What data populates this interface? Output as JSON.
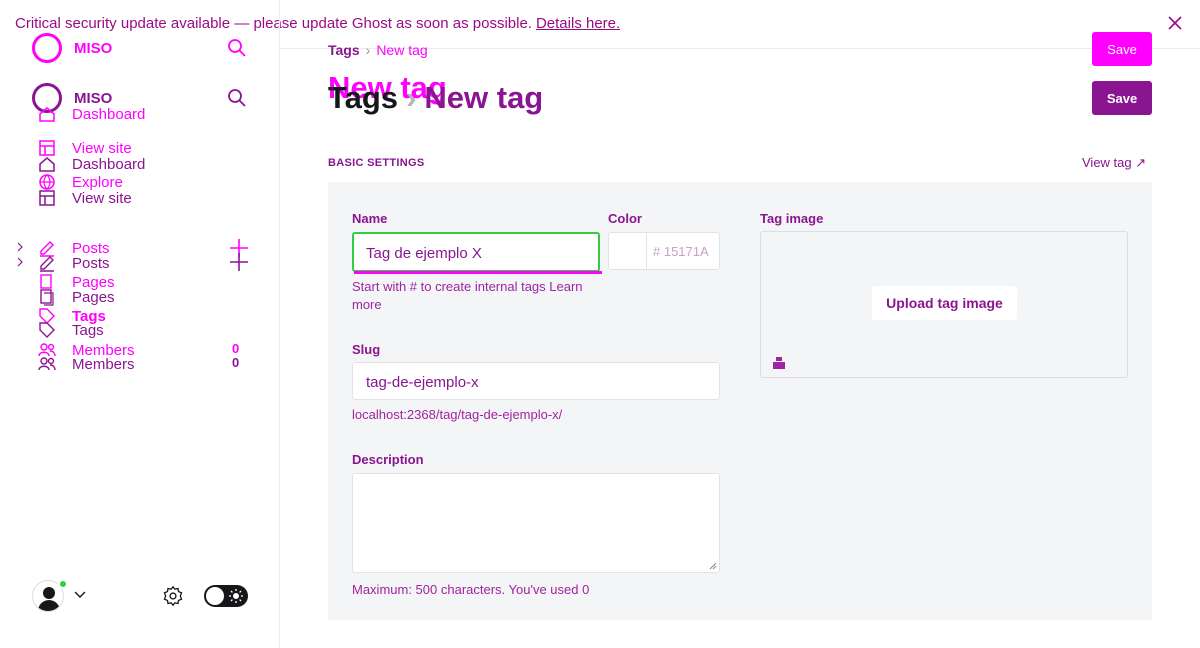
{
  "banner": {
    "message": "Critical security update available — please update Ghost as soon as possible.",
    "link": "Details here."
  },
  "sidebar": {
    "brand": "MISO",
    "brand_dup": "MISO",
    "nav": {
      "dashboard_ghost": "Dashboard",
      "view_site_ghost": "View site",
      "dashboard": "Dashboard",
      "explore": "Explore",
      "view_site": "View site",
      "posts_ghost": "Posts",
      "posts": "Posts",
      "pages_ghost": "Pages",
      "pages": "Pages",
      "tags_ghost": "Tags",
      "tags": "Tags",
      "members_ghost": "Members",
      "members": "Members",
      "members_count_ghost": "0",
      "members_count": "0"
    }
  },
  "header": {
    "breadcrumb_parent": "Tags",
    "breadcrumb_current": "New tag",
    "title_ghost": "New tag",
    "title_parent": "Tags",
    "title_current": "New tag",
    "save_ghost": "Save",
    "save": "Save"
  },
  "form": {
    "section_title": "BASIC SETTINGS",
    "view_tag": "View tag",
    "name_label": "Name",
    "name_value": "Tag de ejemplo X",
    "name_hint": "Start with # to create internal tags Learn more",
    "color_label": "Color",
    "color_hex": "# 15171A",
    "image_label": "Tag image",
    "upload_label": "Upload tag image",
    "slug_label": "Slug",
    "slug_value": "tag-de-ejemplo-x",
    "slug_url": "localhost:2368/tag/tag-de-ejemplo-x/",
    "description_label": "Description",
    "description_hint": "Maximum: 500 characters. You've used 0"
  },
  "colors": {
    "accent": "#ff00ff",
    "brand": "#8a1590",
    "success": "#30cf43"
  }
}
